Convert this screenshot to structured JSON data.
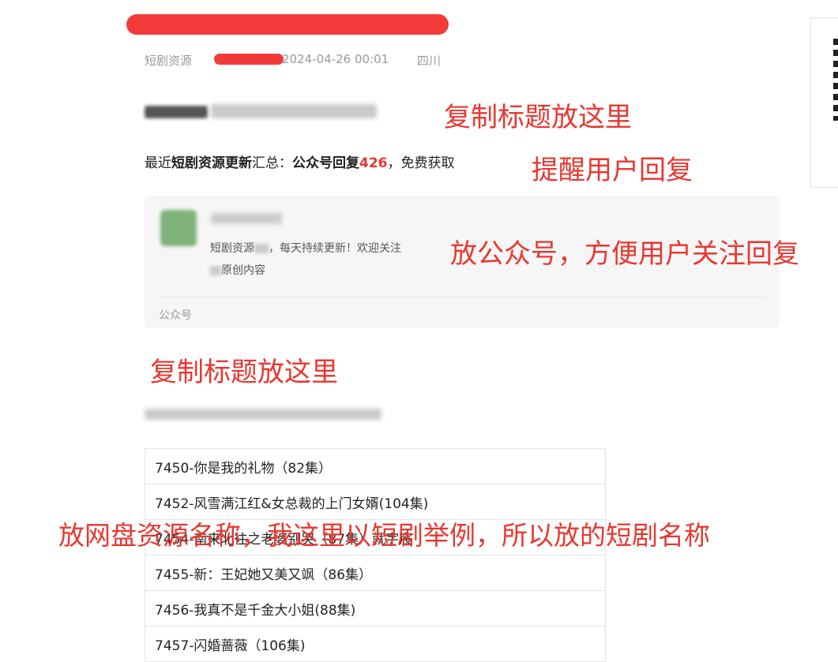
{
  "article": {
    "meta": {
      "category": "短剧资源",
      "date": "2024-04-26 00:01",
      "region": "四川"
    },
    "intro": {
      "prefix": "最近",
      "bold1": "短剧资源更新",
      "mid": "汇总：",
      "bold2": "公众号回复",
      "number": "426",
      "suffix": "，免费获取"
    },
    "account_card": {
      "description": "短剧资源",
      "description_tail": "，每天持续更新！欢迎关注",
      "description2": "原创内容",
      "footer": "公众号"
    },
    "list_items": [
      "7450-你是我的礼物（82集）",
      "7452-风雪满江红&女总裁的上门女婿(104集)",
      "7454-南来北往之老婆别哭（87集）就宇宸",
      "7455-新：王妃她又美又飒（86集）",
      "7456-我真不是千金大小姐(88集)",
      "7457-闪婚蔷薇（106集)"
    ]
  },
  "annotations": {
    "copy_title_1": "复制标题放这里",
    "remind_reply": "提醒用户回复",
    "put_account": "放公众号，方便用户关注回复",
    "copy_title_2": "复制标题放这里",
    "resource_name": "放网盘资源名称，我这里以短剧举例，所以放的短剧名称"
  },
  "colors": {
    "annotation": "#e8372f",
    "highlight_number": "#e8372f",
    "redaction": "#f23a3a"
  }
}
